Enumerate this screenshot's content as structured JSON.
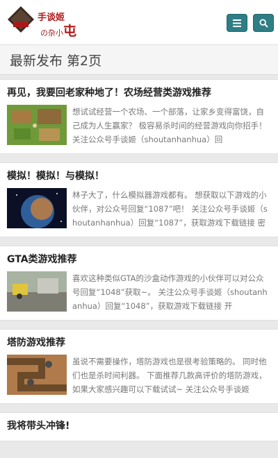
{
  "header": {
    "logo_line1": "手谈姬",
    "logo_line2_prefix": "の",
    "logo_line2_small": "杂小",
    "logo_line2_big": "屯",
    "logo_badge": "手谈",
    "menu_icon": "menu-icon",
    "search_icon": "search-icon",
    "accent_color": "#2f7d85"
  },
  "page_title": "最新发布 第2页",
  "posts": [
    {
      "title": "再见，我要回老家种地了！农场经营类游戏推荐",
      "excerpt": "想试试经营一个农场、一个部落，让家乡变得富饶，自己成为人生赢家？ 极容易杀时间的经营游戏向你招手！ 关注公众号手谈姬（shoutanhanhua）回"
    },
    {
      "title": "模拟！模拟！与模拟！",
      "excerpt": "林子大了，什么模拟器游戏都有。 想获取以下游戏的小伙伴，对公众号回复“1087”吧！ 关注公众号手谈姬（shoutanhanhua）回复“1087”，获取游戏下载链接 密"
    },
    {
      "title": "GTA类游戏推荐",
      "excerpt": "喜欢这种类似GTA的沙盒动作游戏的小伙伴可以对公众号回复“1048”获取~。 关注公众号手谈姬（shoutanhanhua）回复“1048”，获取游戏下载链接 开"
    },
    {
      "title": "塔防游戏推荐",
      "excerpt": "虽说不需要操作，塔防游戏也是很考验策略的。 同时他们也是杀时间利器。 下面推荐几款高评价的塔防游戏，如果大家感兴趣可以下载试试~ 关注公众号手谈姬"
    },
    {
      "title": "我将带头冲锋!",
      "excerpt": ""
    }
  ]
}
